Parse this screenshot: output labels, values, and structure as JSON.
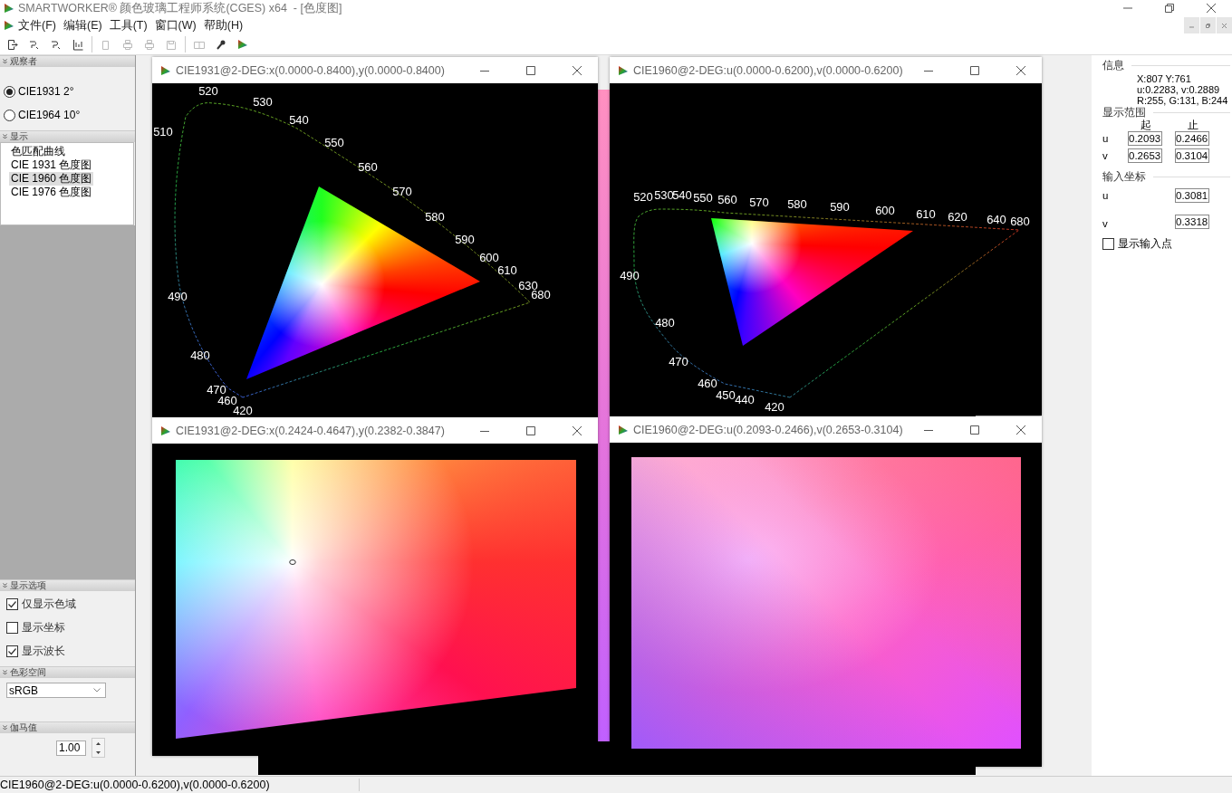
{
  "window": {
    "title": "SMARTWORKER® 颜色玻璃工程师系统(CGES) x64  - [色度图]"
  },
  "menu": [
    "文件(F)",
    "编辑(E)",
    "工具(T)",
    "窗口(W)",
    "帮助(H)"
  ],
  "toolbar": [
    {
      "kind": "export",
      "disabled": false
    },
    {
      "kind": "curve",
      "disabled": false
    },
    {
      "kind": "curve",
      "disabled": false
    },
    {
      "kind": "chart",
      "disabled": false
    },
    {
      "kind": "separator"
    },
    {
      "kind": "copy",
      "disabled": true
    },
    {
      "kind": "print",
      "disabled": true
    },
    {
      "kind": "print",
      "disabled": true
    },
    {
      "kind": "save",
      "disabled": true
    },
    {
      "kind": "separator"
    },
    {
      "kind": "layout",
      "disabled": true
    },
    {
      "kind": "tool",
      "disabled": false
    },
    {
      "kind": "logo",
      "disabled": false
    }
  ],
  "sidebar": {
    "observer": {
      "title": "观察者",
      "options": [
        {
          "label": "CIE1931 2°",
          "selected": true
        },
        {
          "label": "CIE1964 10°",
          "selected": false
        }
      ]
    },
    "display": {
      "title": "显示",
      "items": [
        {
          "label": "色匹配曲线",
          "selected": false
        },
        {
          "label": "CIE 1931 色度图",
          "selected": false
        },
        {
          "label": "CIE 1960 色度图",
          "selected": true
        },
        {
          "label": "CIE 1976 色度图",
          "selected": false
        }
      ]
    },
    "options": {
      "title": "显示选项",
      "checkboxes": [
        {
          "label": "仅显示色域",
          "checked": true
        },
        {
          "label": "显示坐标",
          "checked": false
        },
        {
          "label": "显示波长",
          "checked": true
        }
      ]
    },
    "color_space": {
      "title": "色彩空间",
      "value": "sRGB"
    },
    "gamma": {
      "title": "伽马值",
      "value": "1.00"
    }
  },
  "documents": [
    {
      "kind": "cie1931",
      "title": "CIE1931@2-DEG:x(0.0000-0.8400),y(0.0000-0.8400)",
      "wavelength_labels": [
        "520",
        "530",
        "540",
        "550",
        "560",
        "570",
        "580",
        "590",
        "600",
        "610",
        "630",
        "680",
        "510",
        "490",
        "480",
        "470",
        "460",
        "420"
      ]
    },
    {
      "kind": "cie1960",
      "title": "CIE1960@2-DEG:u(0.0000-0.6200),v(0.0000-0.6200)",
      "wavelength_labels": [
        "520",
        "530",
        "540",
        "550",
        "560",
        "570",
        "580",
        "590",
        "600",
        "610",
        "620",
        "640",
        "680",
        "490",
        "480",
        "470",
        "460",
        "450",
        "440",
        "420"
      ]
    },
    {
      "kind": "cie1931-zoom",
      "title": "CIE1931@2-DEG:x(0.2424-0.4647),y(0.2382-0.3847)"
    },
    {
      "kind": "cie1960-zoom",
      "title": "CIE1960@2-DEG:u(0.2093-0.2466),v(0.2653-0.3104)"
    }
  ],
  "info_panel": {
    "info": {
      "title": "信息",
      "lines": [
        "X:807 Y:761",
        "u:0.2283, v:0.2889",
        "R:255, G:131, B:244"
      ]
    },
    "range": {
      "title": "显示范围",
      "from_label": "起",
      "to_label": "止",
      "rows": [
        {
          "label": "u",
          "from": "0.2093",
          "to": "0.2466"
        },
        {
          "label": "v",
          "from": "0.2653",
          "to": "0.3104"
        }
      ]
    },
    "input": {
      "title": "输入坐标",
      "rows": [
        {
          "label": "u",
          "value": "0.3081"
        },
        {
          "label": "v",
          "value": "0.3318"
        }
      ]
    },
    "show_point": {
      "label": "显示输入点",
      "checked": false
    }
  },
  "status_bar": "CIE1960@2-DEG:u(0.0000-0.6200),v(0.0000-0.6200)"
}
